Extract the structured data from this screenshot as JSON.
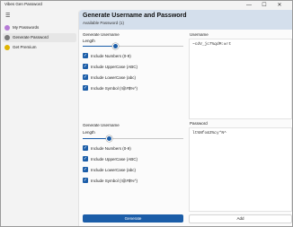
{
  "window": {
    "title": "Vibes Gen Password",
    "controls": {
      "minimize": "—",
      "maximize": "☐",
      "close": "✕"
    }
  },
  "sidebar": {
    "menu_icon": "hamburger-icon",
    "items": [
      {
        "label": "My Passwords",
        "icon": "lock-icon",
        "color": "#b57ad6",
        "selected": false
      },
      {
        "label": "Generate Password",
        "icon": "key-icon",
        "color": "#7a7a7a",
        "selected": true
      },
      {
        "label": "Get Premium",
        "icon": "premium-icon",
        "color": "#e0b400",
        "selected": false
      }
    ]
  },
  "header": {
    "title": "Generate Username and Password",
    "subtitle": "Available Password (1)"
  },
  "username_generator": {
    "section_label": "Generate Username",
    "length_label": "Length",
    "slider_value": 0.3,
    "options": [
      {
        "label": "Include Numbers (0-9)",
        "checked": true
      },
      {
        "label": "Include UpperCase (ABC)",
        "checked": true
      },
      {
        "label": "Include LowerCase (abc)",
        "checked": true
      },
      {
        "label": "Include Symbol (!@#$%^)",
        "checked": true
      }
    ],
    "output_label": "Username",
    "output_value": "~cdV_jc7%qdM:w!t"
  },
  "password_generator": {
    "section_label": "Generate Username",
    "length_label": "Length",
    "slider_value": 0.25,
    "options": [
      {
        "label": "Include Numbers (0-9)",
        "checked": true
      },
      {
        "label": "Include UpperCase (ABC)",
        "checked": true
      },
      {
        "label": "Include LowerCase (abc)",
        "checked": true
      },
      {
        "label": "Include Symbol (!@#$%^)",
        "checked": true
      }
    ],
    "output_label": "Password",
    "output_value": "lt%Nfo&3%cy*N^"
  },
  "actions": {
    "generate_label": "Generate",
    "add_label": "Add"
  },
  "colors": {
    "accent": "#1b5da8",
    "header_band": "#d4dfec"
  }
}
